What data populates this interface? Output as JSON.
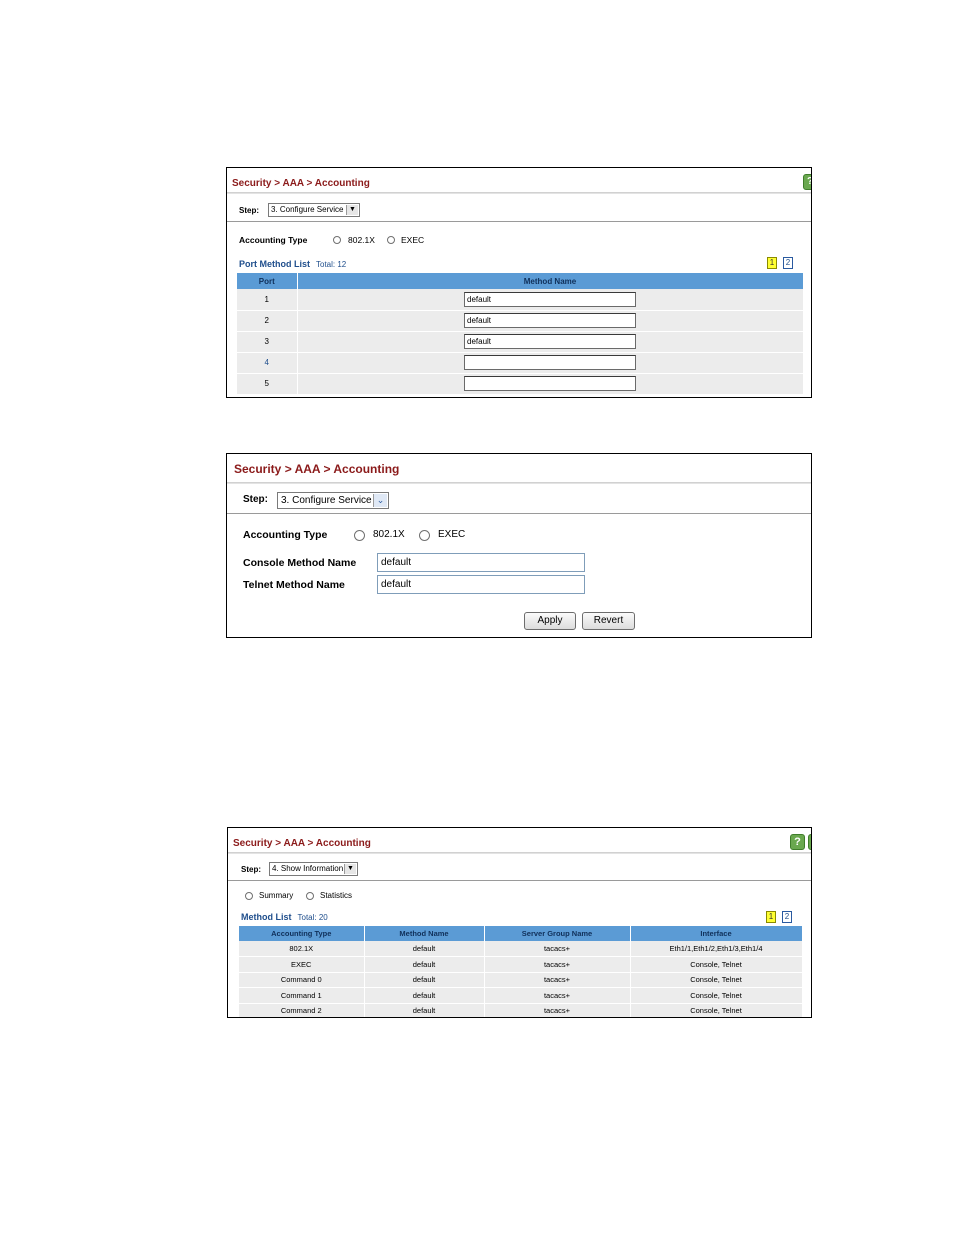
{
  "panel1": {
    "breadcrumb": "Security > AAA > Accounting",
    "step_label": "Step:",
    "step_value": "3. Configure Service",
    "accounting_type_label": "Accounting Type",
    "radio_8021x": "802.1X",
    "radio_exec": "EXEC",
    "selected": "802.1X",
    "list_title": "Port Method List",
    "list_total": "Total: 12",
    "pages": [
      "1",
      "2"
    ],
    "current_page": "1",
    "columns": [
      "Port",
      "Method Name"
    ],
    "rows": [
      {
        "port": "1",
        "method": "default"
      },
      {
        "port": "2",
        "method": "default"
      },
      {
        "port": "3",
        "method": "default"
      },
      {
        "port": "4",
        "method": ""
      },
      {
        "port": "5",
        "method": ""
      }
    ]
  },
  "panel2": {
    "breadcrumb": "Security > AAA > Accounting",
    "step_label": "Step:",
    "step_value": "3. Configure Service",
    "accounting_type_label": "Accounting Type",
    "radio_8021x": "802.1X",
    "radio_exec": "EXEC",
    "selected": "EXEC",
    "console_label": "Console Method Name",
    "console_value": "default",
    "telnet_label": "Telnet Method Name",
    "telnet_value": "default",
    "apply_label": "Apply",
    "revert_label": "Revert"
  },
  "panel3": {
    "breadcrumb": "Security > AAA > Accounting",
    "step_label": "Step:",
    "step_value": "4. Show Information",
    "radio_summary": "Summary",
    "radio_statistics": "Statistics",
    "selected": "Summary",
    "list_title": "Method List",
    "list_total": "Total: 20",
    "pages": [
      "1",
      "2"
    ],
    "current_page": "1",
    "columns": [
      "Accounting Type",
      "Method Name",
      "Server Group Name",
      "Interface"
    ],
    "rows": [
      [
        "802.1X",
        "default",
        "tacacs+",
        "Eth1/1,Eth1/2,Eth1/3,Eth1/4"
      ],
      [
        "EXEC",
        "default",
        "tacacs+",
        "Console, Telnet"
      ],
      [
        "Command 0",
        "default",
        "tacacs+",
        "Console, Telnet"
      ],
      [
        "Command 1",
        "default",
        "tacacs+",
        "Console, Telnet"
      ],
      [
        "Command 2",
        "default",
        "tacacs+",
        "Console, Telnet"
      ]
    ]
  },
  "icons": {
    "help": "help-icon",
    "dropdown": "chevron-down-icon"
  },
  "colors": {
    "breadcrumb": "#8b1a1a",
    "table_header": "#5b9bd5",
    "list_title": "#1f4e8c",
    "current_page": "#ffff33",
    "help_icon": "#6aa84f"
  }
}
